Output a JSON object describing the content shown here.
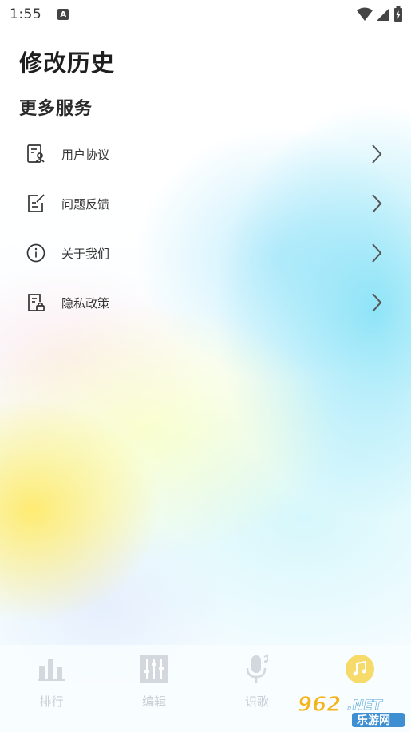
{
  "status_bar": {
    "time": "1:55",
    "app_icon_letter": "A",
    "icons": [
      "wifi-icon",
      "signal-icon",
      "battery-charging-icon"
    ]
  },
  "page": {
    "title": "修改历史",
    "section_title": "更多服务"
  },
  "menu": {
    "items": [
      {
        "label": "用户协议",
        "icon": "user-agreement-icon"
      },
      {
        "label": "问题反馈",
        "icon": "feedback-edit-icon"
      },
      {
        "label": "关于我们",
        "icon": "info-circle-icon"
      },
      {
        "label": "隐私政策",
        "icon": "privacy-lock-document-icon"
      }
    ]
  },
  "tabbar": {
    "tabs": [
      {
        "label": "排行",
        "icon": "bar-chart-icon",
        "active": false
      },
      {
        "label": "编辑",
        "icon": "equalizer-icon",
        "active": false
      },
      {
        "label": "识歌",
        "icon": "microphone-icon",
        "active": false
      },
      {
        "label": "",
        "icon": "music-note-icon",
        "active": true
      }
    ]
  },
  "watermark": {
    "brand_number": "962",
    "brand_suffix": ".NET",
    "brand_cn": "乐游网"
  },
  "colors": {
    "active_tab": "#f6da6a",
    "inactive_tab": "#d3d8de",
    "icon_stroke": "#333333",
    "chevron": "#555555"
  }
}
